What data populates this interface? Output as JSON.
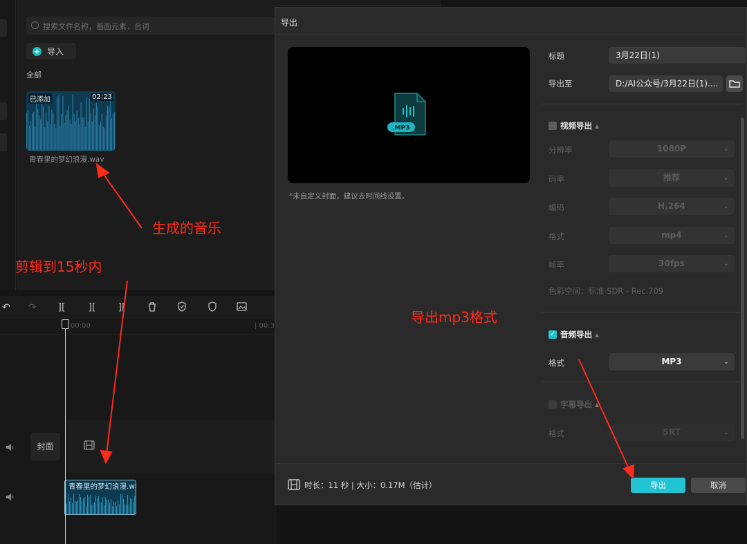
{
  "media": {
    "search_placeholder": "搜索文件名称，画面元素，台词",
    "import_label": "导入",
    "all_label": "全部",
    "card": {
      "added_badge": "已添加",
      "duration": "02:23",
      "filename": "青春里的梦幻浪漫.wav"
    }
  },
  "timeline": {
    "ruler_start": "00:00",
    "ruler_next": "| 00:3",
    "cover_label": "封面",
    "clip_name": "青春里的梦幻浪漫.wav"
  },
  "annotations": {
    "generated_music": "生成的音乐",
    "trim_note": "剪辑到15秒内",
    "export_note": "导出mp3格式"
  },
  "dialog": {
    "title": "导出",
    "cover_note": "*未自定义封面，建议去时间线设置。",
    "preview_badge": ".MP3",
    "title_label": "标题",
    "title_value": "3月22日(1)",
    "export_to_label": "导出至",
    "export_to_value": "D:/AI公众号/3月22日(1)....",
    "video_section": {
      "label": "视频导出",
      "checked": false,
      "fields": [
        {
          "label": "分辨率",
          "value": "1080P"
        },
        {
          "label": "码率",
          "value": "推荐"
        },
        {
          "label": "编码",
          "value": "H.264"
        },
        {
          "label": "格式",
          "value": "mp4"
        },
        {
          "label": "帧率",
          "value": "30fps"
        }
      ],
      "color_space": "色彩空间：标准 SDR - Rec.709"
    },
    "audio_section": {
      "label": "音频导出",
      "checked": true,
      "format_label": "格式",
      "format_value": "MP3"
    },
    "subtitle_section": {
      "label": "字幕导出",
      "checked": false,
      "format_label": "格式",
      "format_value": "SRT"
    },
    "footer": {
      "info": "时长：11 秒 | 大小：0.17M（估计）",
      "export_label": "导出",
      "cancel_label": "取消"
    }
  },
  "colors": {
    "accent": "#22c3d3",
    "annotation": "#ff2a1a",
    "dialog_bg": "#2a2a2a"
  }
}
